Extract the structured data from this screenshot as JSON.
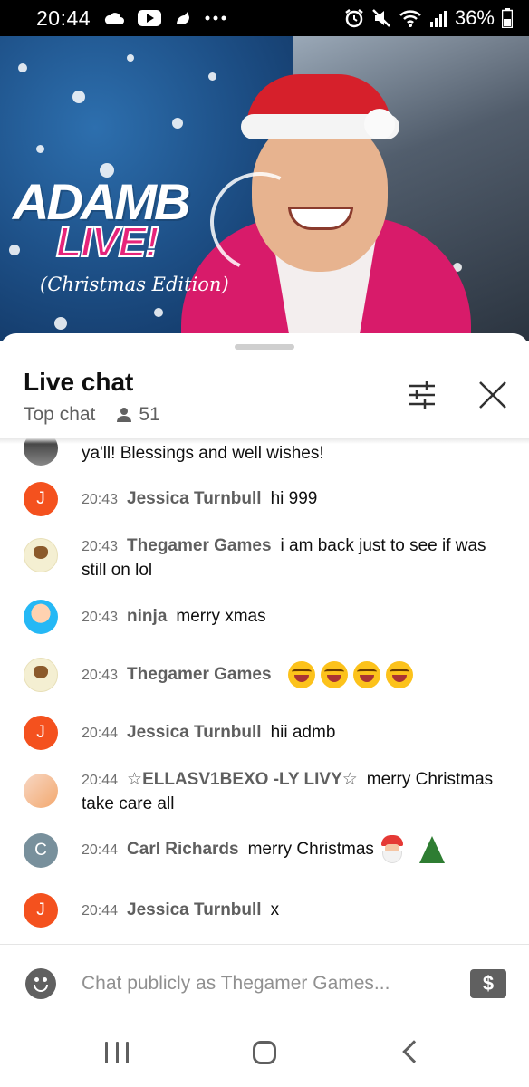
{
  "status_bar": {
    "time": "20:44",
    "left_icons": [
      "cloud-icon",
      "youtube-icon",
      "app-icon",
      "more-dots-icon"
    ],
    "right_icons": [
      "alarm-icon",
      "mute-icon",
      "wifi-icon",
      "signal-icon"
    ],
    "battery": "36%"
  },
  "video": {
    "title_line1": "ADAMB",
    "title_line2": "LIVE!",
    "title_line3": "(Christmas Edition)"
  },
  "chat": {
    "title": "Live chat",
    "mode": "Top chat",
    "viewer_count": "51",
    "messages": [
      {
        "avatar_letter": "",
        "time": "",
        "author": "",
        "text": "ya'll! Blessings and well wishes!"
      },
      {
        "avatar_letter": "J",
        "time": "20:43",
        "author": "Jessica Turnbull",
        "text": "hi 999"
      },
      {
        "avatar_letter": "",
        "time": "20:43",
        "author": "Thegamer Games",
        "text": "i am back just to see if was still on lol"
      },
      {
        "avatar_letter": "",
        "time": "20:43",
        "author": "ninja",
        "text": "merry xmas"
      },
      {
        "avatar_letter": "",
        "time": "20:43",
        "author": "Thegamer Games",
        "text": ""
      },
      {
        "avatar_letter": "J",
        "time": "20:44",
        "author": "Jessica Turnbull",
        "text": "hii admb"
      },
      {
        "avatar_letter": "",
        "time": "20:44",
        "author": "☆ELLASV1BEXO -LY LIVY☆",
        "text": "merry Christmas take care all"
      },
      {
        "avatar_letter": "C",
        "time": "20:44",
        "author": "Carl Richards",
        "text": "merry Christmas"
      },
      {
        "avatar_letter": "J",
        "time": "20:44",
        "author": "Jessica Turnbull",
        "text": "x"
      }
    ],
    "input_placeholder": "Chat publicly as Thegamer Games...",
    "superchat_symbol": "$"
  }
}
